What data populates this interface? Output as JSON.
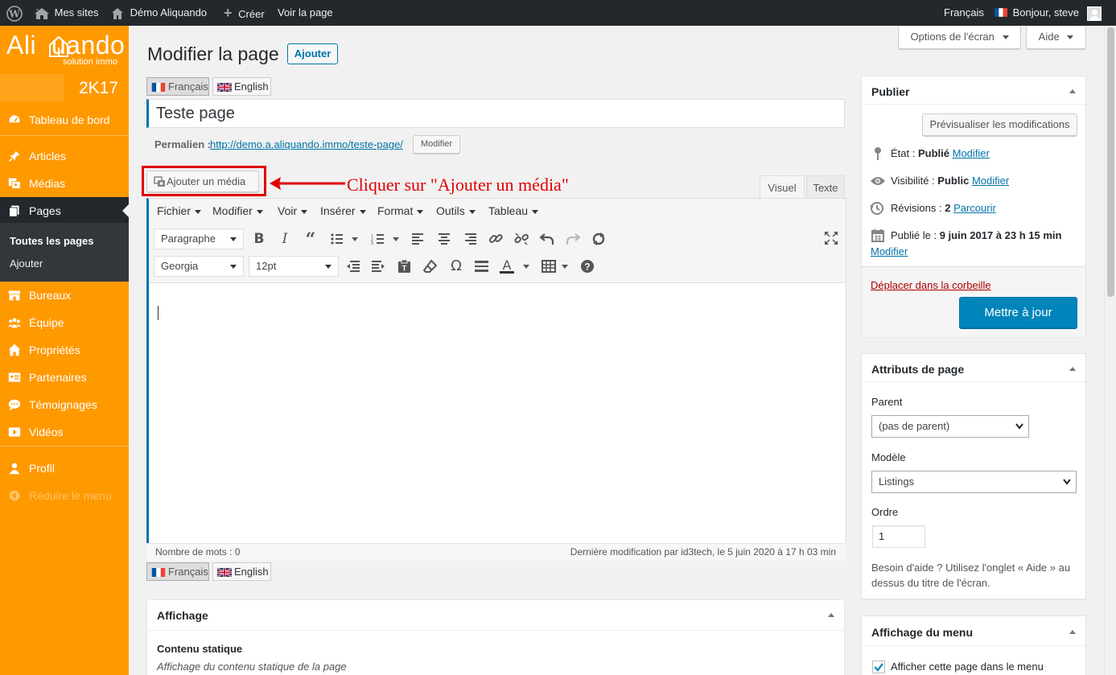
{
  "adminbar": {
    "my_sites": "Mes sites",
    "site_name": "Démo Aliquando",
    "create": "Créer",
    "view_page": "Voir la page",
    "language": "Français",
    "greeting": "Bonjour, steve"
  },
  "sidebar": {
    "logo_text": "Ali  uando",
    "logo_sub": "solution immo",
    "badge": "2K17",
    "items": [
      {
        "label": "Tableau de bord",
        "icon": "dashboard-icon"
      },
      {
        "label": "Articles",
        "icon": "pin-icon"
      },
      {
        "label": "Médias",
        "icon": "media-icon"
      },
      {
        "label": "Pages",
        "icon": "pages-icon"
      },
      {
        "label": "Bureaux",
        "icon": "store-icon"
      },
      {
        "label": "Équipe",
        "icon": "groups-icon"
      },
      {
        "label": "Propriétés",
        "icon": "home-icon"
      },
      {
        "label": "Partenaires",
        "icon": "id-card-icon"
      },
      {
        "label": "Témoignages",
        "icon": "testimonial-icon"
      },
      {
        "label": "Vidéos",
        "icon": "video-icon"
      },
      {
        "label": "Profil",
        "icon": "user-icon"
      },
      {
        "label": "Réduire le menu",
        "icon": "collapse-icon"
      }
    ],
    "submenu": {
      "all_pages": "Toutes les pages",
      "add": "Ajouter"
    }
  },
  "header": {
    "screen_options": "Options de l'écran",
    "help": "Aide",
    "title": "Modifier la page",
    "add_button": "Ajouter"
  },
  "lang_tabs": {
    "fr": "Français",
    "en": "English"
  },
  "post": {
    "title": "Teste page",
    "permalink_label": "Permalien :",
    "permalink_url": "http://demo.a.aliquando.immo/teste-page/",
    "permalink_edit": "Modifier"
  },
  "editor": {
    "add_media": "Ajouter un média",
    "annotation": "Cliquer sur \"Ajouter un média\"",
    "tab_visual": "Visuel",
    "tab_text": "Texte",
    "menubar": [
      "Fichier",
      "Modifier",
      "Voir",
      "Insérer",
      "Format",
      "Outils",
      "Tableau"
    ],
    "format_select": "Paragraphe",
    "font_select": "Georgia",
    "size_select": "12pt",
    "word_count": "Nombre de mots : 0",
    "last_modified": "Dernière modification par id3tech, le 5 juin 2020 à 17 h 03 min"
  },
  "affichage": {
    "title": "Affichage",
    "static_label": "Contenu statique",
    "static_desc": "Affichage du contenu statique de la page"
  },
  "publish": {
    "title": "Publier",
    "preview": "Prévisualiser les modifications",
    "status_label": "État : ",
    "status_value": "Publié",
    "visibility_label": "Visibilité : ",
    "visibility_value": "Public",
    "revisions_label": "Révisions : ",
    "revisions_value": "2",
    "revisions_link": "Parcourir",
    "published_label": "Publié le : ",
    "published_value": "9 juin 2017 à 23 h 15 min",
    "modify": "Modifier",
    "trash": "Déplacer dans la corbeille",
    "update": "Mettre à jour"
  },
  "attributes": {
    "title": "Attributs de page",
    "parent_label": "Parent",
    "parent_value": "(pas de parent)",
    "template_label": "Modèle",
    "template_value": "Listings",
    "order_label": "Ordre",
    "order_value": "1",
    "help_text": "Besoin d'aide ? Utilisez l'onglet « Aide » au dessus du titre de l'écran."
  },
  "menu_box": {
    "title": "Affichage du menu",
    "checkbox_label": "Afficher cette page dans le menu"
  },
  "colors": {
    "sidebar": "#ff9900",
    "adminbar": "#23282d",
    "primary": "#0085ba",
    "annotation": "#e00000"
  }
}
